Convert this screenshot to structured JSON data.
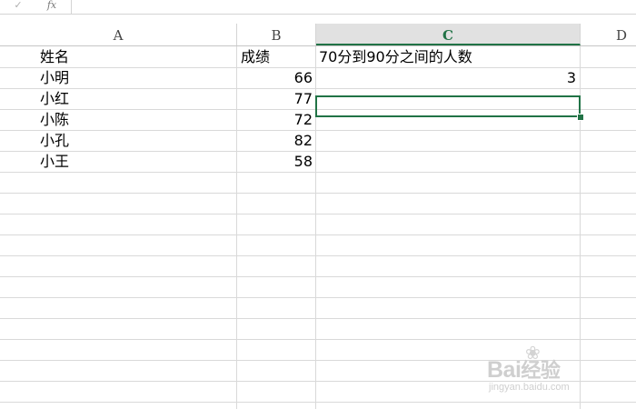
{
  "formula_bar": {
    "cancel_icon": "✓",
    "fx_icon": "fx",
    "value": ""
  },
  "columns": [
    "A",
    "B",
    "C",
    "D"
  ],
  "selected_column": "C",
  "rows": [
    {
      "a": "姓名",
      "b": "成绩",
      "c": "70分到90分之间的人数"
    },
    {
      "a": "小明",
      "b": "66",
      "c": "3"
    },
    {
      "a": "小红",
      "b": "77",
      "c": ""
    },
    {
      "a": "小陈",
      "b": "72",
      "c": ""
    },
    {
      "a": "小孔",
      "b": "82",
      "c": ""
    },
    {
      "a": "小王",
      "b": "58",
      "c": ""
    }
  ],
  "watermark": {
    "logo": "Bai",
    "logo_suffix": "经验",
    "url": "jingyan.baidu.com"
  },
  "colors": {
    "accent": "#217346",
    "gridline": "#d9d9d9",
    "header_selected_bg": "#e1e1e1"
  }
}
